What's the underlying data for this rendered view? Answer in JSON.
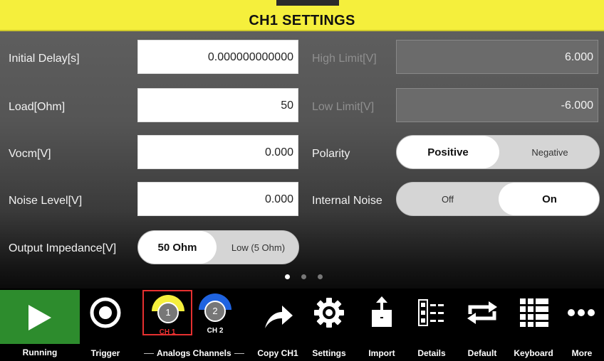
{
  "header": {
    "title": "CH1 SETTINGS"
  },
  "fields": {
    "initial_delay": {
      "label": "Initial Delay[s]",
      "value": "0.000000000000"
    },
    "load": {
      "label": "Load[Ohm]",
      "value": "50"
    },
    "vocm": {
      "label": "Vocm[V]",
      "value": "0.000"
    },
    "noise_level": {
      "label": "Noise Level[V]",
      "value": "0.000"
    },
    "output_impedance": {
      "label": "Output Impedance[V]",
      "options": [
        "50 Ohm",
        "Low (5 Ohm)"
      ],
      "selected": "50 Ohm"
    },
    "high_limit": {
      "label": "High Limit[V]",
      "value": "6.000"
    },
    "low_limit": {
      "label": "Low Limit[V]",
      "value": "-6.000"
    },
    "polarity": {
      "label": "Polarity",
      "options": [
        "Positive",
        "Negative"
      ],
      "selected": "Positive"
    },
    "internal_noise": {
      "label": "Internal Noise",
      "options": [
        "Off",
        "On"
      ],
      "selected": "On"
    }
  },
  "pager": {
    "pages": 3,
    "current": 1
  },
  "toolbar": {
    "running": "Running",
    "trigger": "Trigger",
    "analog_channels": "Analogs Channels",
    "ch1": {
      "number": "1",
      "label": "CH 1"
    },
    "ch2": {
      "number": "2",
      "label": "CH 2"
    },
    "copy": "Copy CH1",
    "settings": "Settings",
    "import": "Import",
    "details": "Details",
    "default": "Default",
    "keyboard": "Keyboard",
    "more": "More"
  },
  "colors": {
    "header_bg": "#f5ef3c",
    "running_bg": "#2d8c2d",
    "ch1_color": "#f5ef3c",
    "ch2_color": "#1f63e0",
    "selected_border": "#e53030"
  }
}
